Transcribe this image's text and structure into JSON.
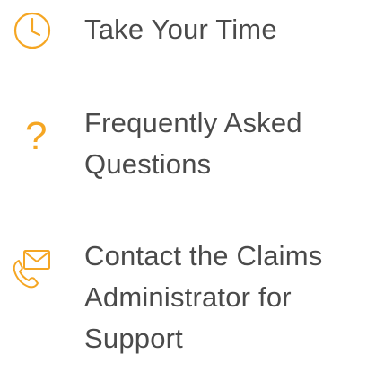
{
  "colors": {
    "accent": "#f5a623",
    "text": "#4a4a4a"
  },
  "items": [
    {
      "icon": "clock-icon",
      "lines": [
        "Take Your Time"
      ]
    },
    {
      "icon": "question-mark-icon",
      "glyph": "?",
      "lines": [
        "Frequently Asked",
        "Questions"
      ]
    },
    {
      "icon": "envelope-phone-icon",
      "lines": [
        "Contact the Claims",
        "Administrator for",
        "Support"
      ]
    }
  ]
}
